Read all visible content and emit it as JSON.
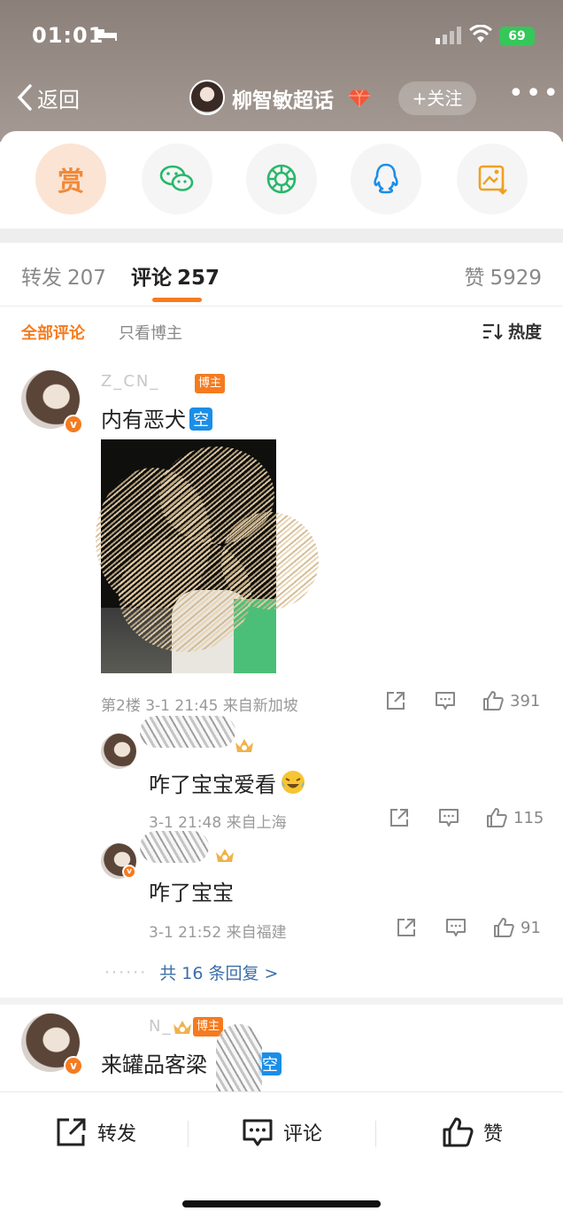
{
  "status": {
    "time": "01:01",
    "battery": "69"
  },
  "nav": {
    "back": "返回",
    "title": "柳智敏超话",
    "follow": "+关注",
    "more": "•••"
  },
  "share": {
    "reward": "赏"
  },
  "tabs": {
    "repost_label": "转发",
    "repost_count": "207",
    "comment_label": "评论",
    "comment_count": "257",
    "like_label": "赞",
    "like_count": "5929"
  },
  "filter": {
    "all": "全部评论",
    "author_only": "只看博主",
    "sort": "热度"
  },
  "comments": [
    {
      "username": "Z_CN_",
      "author_tag": "博主",
      "text": "内有恶犬",
      "badge": "空",
      "floor": "第2楼",
      "time": "3-1 21:45",
      "location": "来自新加坡",
      "likes": "391",
      "replies": [
        {
          "text": "咋了宝宝爱看",
          "time": "3-1 21:48",
          "location": "来自上海",
          "likes": "115"
        },
        {
          "text": "咋了宝宝",
          "time": "3-1 21:52",
          "location": "来自福建",
          "likes": "91"
        }
      ],
      "more_replies": "共 16 条回复 >"
    },
    {
      "username": "N_",
      "author_tag": "博主",
      "text": "来罐品客梁",
      "badge": "空"
    }
  ],
  "bottom": {
    "repost": "转发",
    "comment": "评论",
    "like": "赞"
  },
  "colors": {
    "accent": "#f57b1f",
    "link": "#3b6ea8",
    "badge_blue": "#1a8ee8"
  }
}
